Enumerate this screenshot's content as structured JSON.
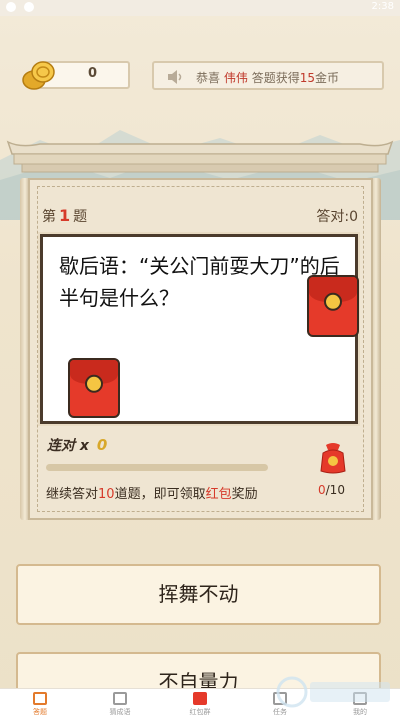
{
  "status_bar": {
    "time": "2:38"
  },
  "coins": {
    "value": "0"
  },
  "notice": {
    "prefix": "恭喜",
    "name": "伟伟",
    "middle": "答题获得",
    "amount": "15",
    "suffix": "金币"
  },
  "question": {
    "number_prefix": "第",
    "number": "1",
    "number_suffix": "题",
    "answered_label": "答对:0",
    "text": "歇后语：“关公门前耍大刀”的后半句是什么？"
  },
  "streak": {
    "label": "连对 x",
    "value": "0"
  },
  "progress": {
    "fraction": 0
  },
  "tip": {
    "pre": "继续答对",
    "count": "10",
    "mid": "道题，即可领取",
    "reward": "红包",
    "post": "奖励"
  },
  "bag": {
    "current": "0",
    "total": "/10"
  },
  "options": [
    "挥舞不动",
    "不自量力"
  ],
  "tabs": [
    {
      "label": "答题",
      "icon": "quiz-icon",
      "active": true
    },
    {
      "label": "猜成语",
      "icon": "idiom-icon",
      "active": false
    },
    {
      "label": "红包群",
      "icon": "red-packet-icon",
      "active": false
    },
    {
      "label": "任务",
      "icon": "task-icon",
      "active": false
    },
    {
      "label": "我的",
      "icon": "profile-icon",
      "active": false
    }
  ],
  "colors": {
    "accent": "#e37a2b",
    "highlight_red": "#d63a2a",
    "gold": "#d8a82b"
  }
}
